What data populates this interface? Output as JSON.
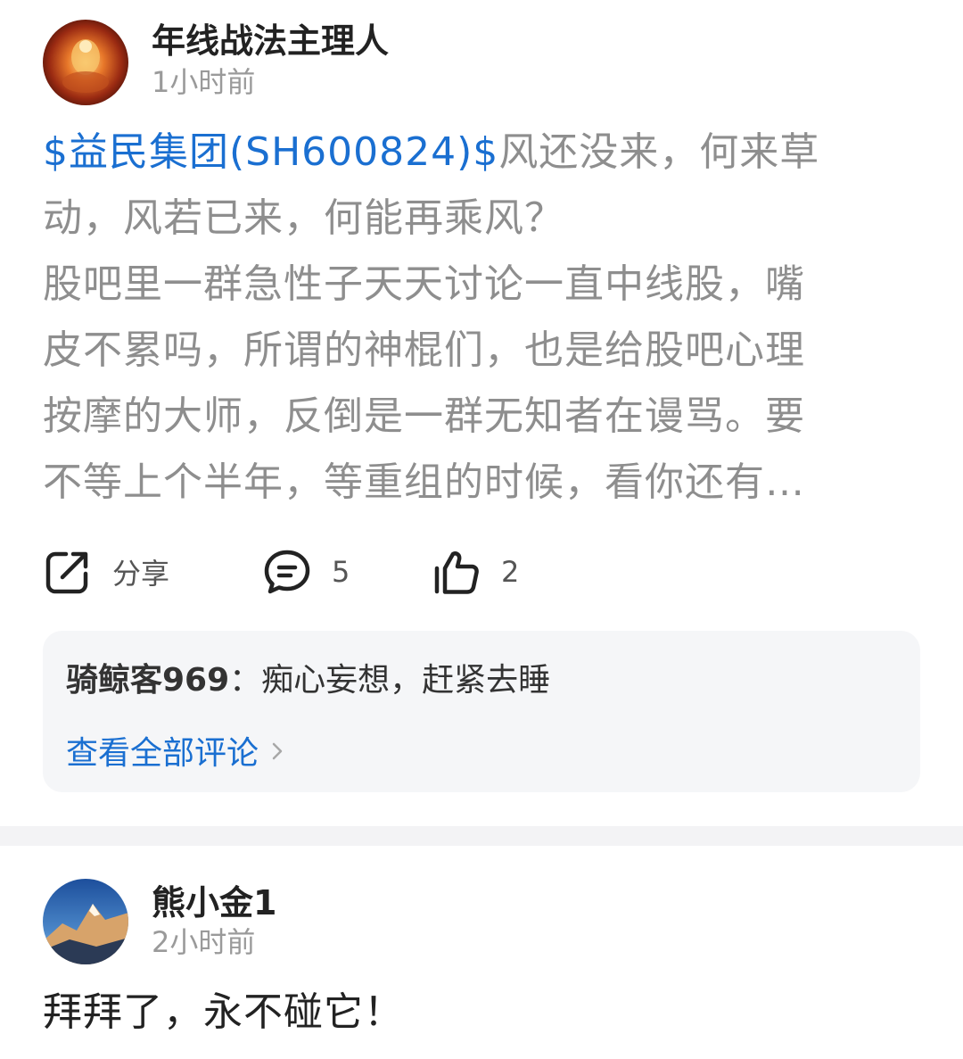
{
  "post1": {
    "author": "年线战法主理人",
    "time": "1小时前",
    "stock_tag": "$益民集团(SH600824)$",
    "body_lines": [
      "风还没来，何来草",
      "动，风若已来，何能再乘风？",
      "股吧里一群急性子天天讨论一直中线股，嘴",
      "皮不累吗，所谓的神棍们，也是给股吧心理",
      "按摩的大师，反倒是一群无知者在谩骂。要",
      "不等上个半年，等重组的时候，看你还有…"
    ],
    "actions": {
      "share_label": "分享",
      "comment_count": "5",
      "like_count": "2"
    },
    "top_comment": {
      "user": "骑鲸客969",
      "separator": "：",
      "text": "痴心妄想，赶紧去睡"
    },
    "view_all_label": "查看全部评论"
  },
  "post2": {
    "author": "熊小金1",
    "time": "2小时前",
    "body": "拜拜了，永不碰它！"
  },
  "colors": {
    "link": "#1a6fd1",
    "muted_text": "#8e8e8e",
    "comment_bg": "#f5f6f8"
  },
  "icons": {
    "share": "share-icon",
    "comment": "comment-bubble-icon",
    "like": "thumbs-up-icon",
    "chevron": "chevron-right-icon"
  }
}
